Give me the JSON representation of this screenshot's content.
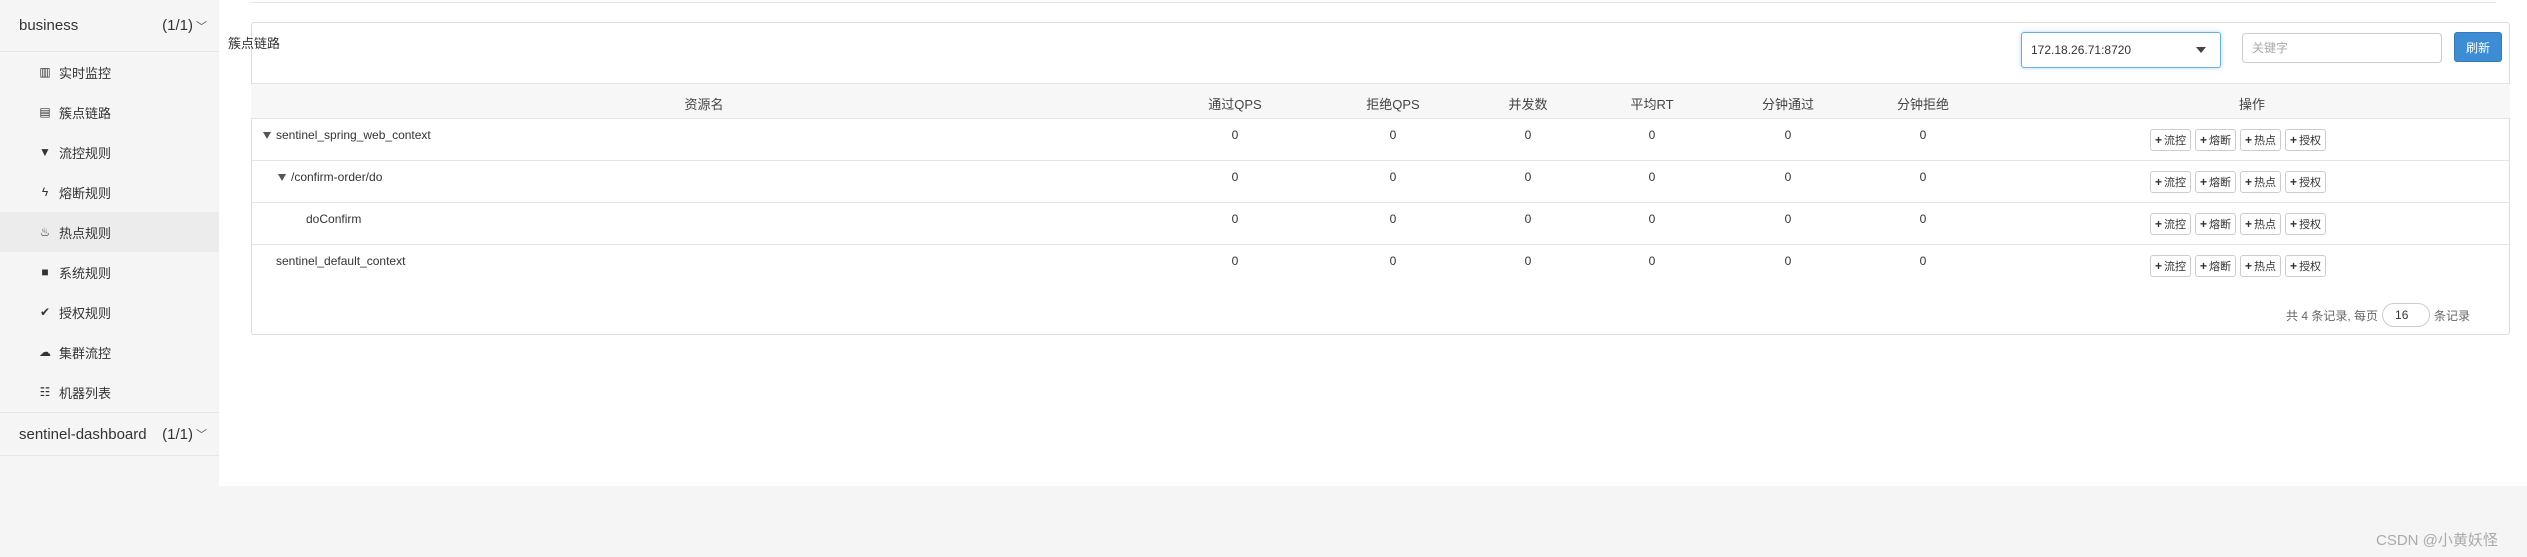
{
  "sidebar": {
    "apps": [
      {
        "name": "business",
        "count": "(1/1)"
      },
      {
        "name": "sentinel-dashboard",
        "count": "(1/1)"
      }
    ],
    "menu": [
      {
        "icon": "bar-chart-icon",
        "glyph": "▥",
        "label": "实时监控"
      },
      {
        "icon": "list-icon",
        "glyph": "▤",
        "label": "簇点链路"
      },
      {
        "icon": "filter-icon",
        "glyph": "▼",
        "label": "流控规则"
      },
      {
        "icon": "flash-icon",
        "glyph": "ϟ",
        "label": "熔断规则"
      },
      {
        "icon": "fire-icon",
        "glyph": "♨",
        "label": "热点规则"
      },
      {
        "icon": "lock-icon",
        "glyph": "■",
        "label": "系统规则"
      },
      {
        "icon": "check-circle-icon",
        "glyph": "✔",
        "label": "授权规则"
      },
      {
        "icon": "cloud-icon",
        "glyph": "☁",
        "label": "集群流控"
      },
      {
        "icon": "th-list-icon",
        "glyph": "☷",
        "label": "机器列表"
      }
    ],
    "active_index": 4
  },
  "panel": {
    "title": "簇点链路",
    "machine_select": "172.18.26.71:8720",
    "search_placeholder": "关键字",
    "refresh_label": "刷新"
  },
  "table": {
    "headers": [
      "资源名",
      "通过QPS",
      "拒绝QPS",
      "并发数",
      "平均RT",
      "分钟通过",
      "分钟拒绝",
      "操作"
    ],
    "rows": [
      {
        "name": "sentinel_spring_web_context",
        "expand": true,
        "indent": 0,
        "values": [
          "0",
          "0",
          "0",
          "0",
          "0",
          "0"
        ]
      },
      {
        "name": "/confirm-order/do",
        "expand": true,
        "indent": 1,
        "values": [
          "0",
          "0",
          "0",
          "0",
          "0",
          "0"
        ]
      },
      {
        "name": "doConfirm",
        "expand": false,
        "indent": 2,
        "values": [
          "0",
          "0",
          "0",
          "0",
          "0",
          "0"
        ]
      },
      {
        "name": "sentinel_default_context",
        "expand": false,
        "indent": 0,
        "values": [
          "0",
          "0",
          "0",
          "0",
          "0",
          "0"
        ]
      }
    ],
    "ops": [
      "流控",
      "熔断",
      "热点",
      "授权"
    ]
  },
  "pager": {
    "total_text": "共 4 条记录, 每页",
    "page_size": "16",
    "suffix": "条记录"
  },
  "watermark": "CSDN @小黄妖怪"
}
